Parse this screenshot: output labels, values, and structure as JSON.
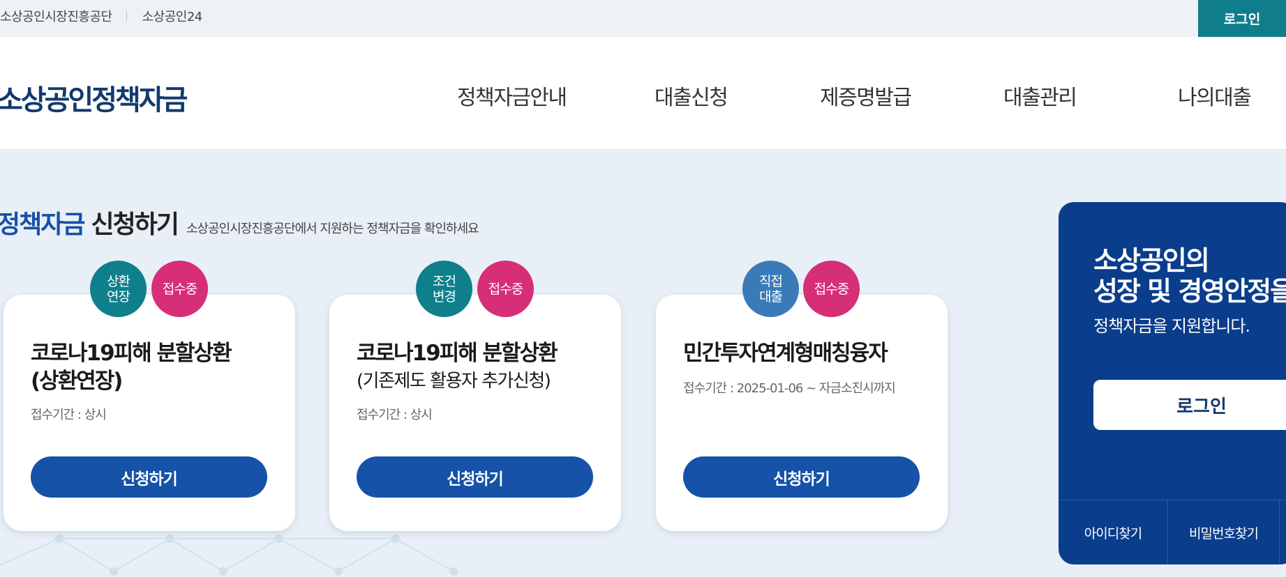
{
  "util": {
    "link1": "소상공인시장진흥공단",
    "link2": "소상공인24",
    "login": "로그인"
  },
  "header": {
    "logo": "소상공인정책자금",
    "nav": [
      "정책자금안내",
      "대출신청",
      "제증명발급",
      "대출관리",
      "나의대출"
    ]
  },
  "main": {
    "title_highlight": "정책자금",
    "title_rest": "신청하기",
    "subtitle": "소상공인시장진흥공단에서 지원하는 정책자금을 확인하세요"
  },
  "cards": [
    {
      "badge_type": "상환\n연장",
      "badge_status": "접수중",
      "title_line1": "코로나19피해 분할상환",
      "title_line2": "(상환연장)",
      "period": "접수기간 : 상시",
      "button": "신청하기"
    },
    {
      "badge_type": "조건\n변경",
      "badge_status": "접수중",
      "title_line1": "코로나19피해 분할상환",
      "title_line2": "(기존제도 활용자 추가신청)",
      "period": "접수기간 : 상시",
      "button": "신청하기"
    },
    {
      "badge_type": "직접\n대출",
      "badge_status": "접수중",
      "title_line1": "민간투자연계형매칭융자",
      "title_line2": "",
      "period": "접수기간 : 2025-01-06 ~ 자금소진시까지",
      "button": "신청하기"
    }
  ],
  "login_panel": {
    "line1": "소상공인의",
    "line2": "성장 및 경영안정을",
    "line3": "정책자금을 지원합니다.",
    "login": "로그인",
    "find_id": "아이디찾기",
    "find_pw": "비밀번호찾기"
  },
  "colors": {
    "primary": "#1552a8",
    "teal": "#0f7d8c",
    "pink": "#d62f77",
    "navy": "#0a3d8c",
    "background": "#e8eff6"
  }
}
